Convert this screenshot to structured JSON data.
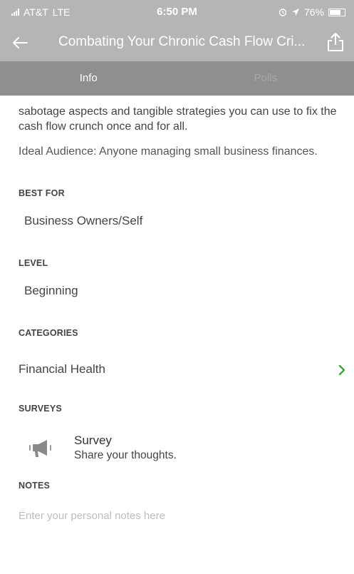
{
  "status": {
    "carrier": "AT&T",
    "network": "LTE",
    "time": "6:50 PM",
    "battery": "76%",
    "battery_level": 0.76
  },
  "nav": {
    "title": "Combating Your Chronic Cash Flow Cri..."
  },
  "tabs": [
    {
      "label": "Info",
      "active": true
    },
    {
      "label": "Polls",
      "active": false
    }
  ],
  "info": {
    "description": "sabotage aspects and tangible strategies you can use to fix the cash flow crunch once and for all.",
    "audience": "Ideal Audience: Anyone managing small business finances."
  },
  "best_for": {
    "label": "BEST FOR",
    "value": "Business Owners/Self"
  },
  "level": {
    "label": "LEVEL",
    "value": "Beginning"
  },
  "categories": {
    "label": "CATEGORIES",
    "value": "Financial Health"
  },
  "surveys": {
    "label": "SURVEYS",
    "items": [
      {
        "title": "Survey",
        "subtitle": "Share your thoughts.",
        "icon": "megaphone-icon"
      }
    ]
  },
  "notes": {
    "label": "NOTES",
    "placeholder": "Enter your personal notes here"
  },
  "colors": {
    "header_bg": "#b5b5b5",
    "tab_bg": "#8f8f8f",
    "chevron": "#3aa53a"
  }
}
